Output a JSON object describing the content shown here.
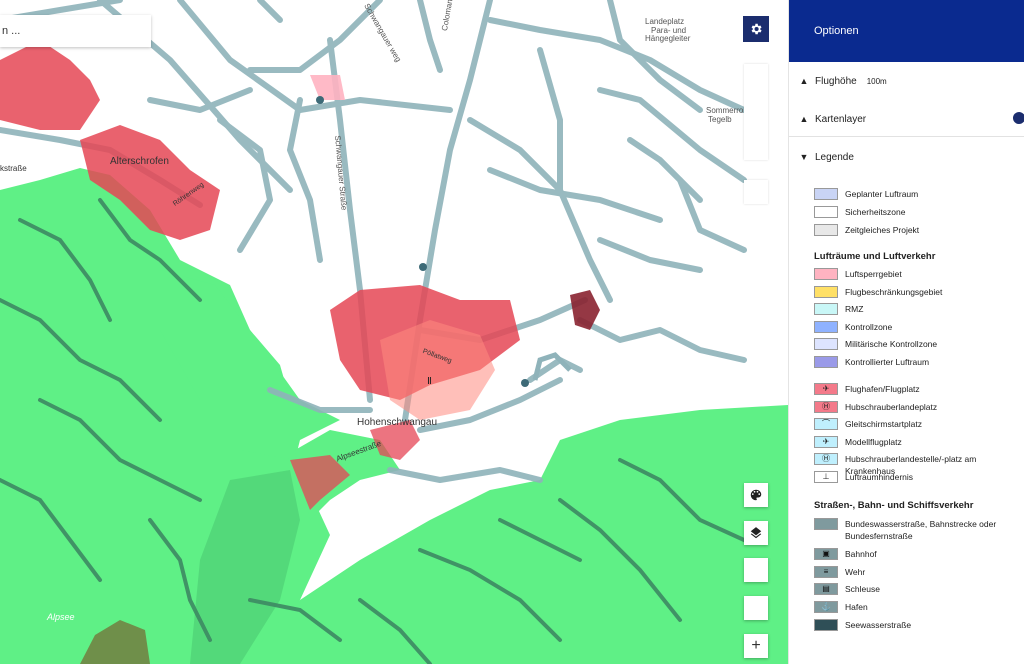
{
  "search": {
    "value": "n ..."
  },
  "map_labels": {
    "landeplatz": "Landeplatz",
    "para": "Para- und",
    "haengegleiter": "Hängegleiter",
    "sommerrodel": "Sommerro",
    "tegelb": "Tegelb",
    "colomanstrasse": "Colomanstraße",
    "schwangauer_strasse": "Schwangauer Straße",
    "alterschrofen": "Alterschrofen",
    "roehrenweg": "Röhrenweg",
    "strasse_left": "kstraße",
    "pollatweg": "Pöllatweg",
    "hohenschwangau": "Hohenschwangau",
    "alpseestrasse": "Alpseestraße",
    "alpsee": "Alpsee",
    "top_road": "Schwangauer weg"
  },
  "controls": {
    "settings_icon": "gear-icon",
    "palette_icon": "palette-icon",
    "layers_icon": "layers-icon",
    "zoom_in": "+"
  },
  "panel": {
    "title": "Optionen",
    "flughoehe_label": "Flughöhe",
    "flughoehe_value": "100m",
    "kartenlayer_label": "Kartenlayer",
    "legende_label": "Legende",
    "legend_top": [
      {
        "label": "Geplanter Luftraum",
        "color": "#c9d4f5"
      },
      {
        "label": "Sicherheitszone",
        "color": "#ffffff"
      },
      {
        "label": "Zeitgleiches Projekt",
        "color": "#e8e8e8"
      }
    ],
    "airspace_heading": "Lufträume und Luftverkehr",
    "airspace_items": [
      {
        "label": "Luftsperrgebiet",
        "color": "#ffb3c1"
      },
      {
        "label": "Flugbeschränkungsgebiet",
        "color": "#ffe066"
      },
      {
        "label": "RMZ",
        "color": "#c9f7f7"
      },
      {
        "label": "Kontrollzone",
        "color": "#8fb2ff"
      },
      {
        "label": "Militärische Kontrollzone",
        "color": "#dde4ff"
      },
      {
        "label": "Kontrollierter Luftraum",
        "color": "#9a9ae8"
      }
    ],
    "airport_items": [
      {
        "label": "Flughafen/Flugplatz",
        "color": "#f47a8a",
        "icon": "airplane-icon"
      },
      {
        "label": "Hubschrauberlandeplatz",
        "color": "#f47a8a",
        "icon": "helipad-icon"
      },
      {
        "label": "Gleitschirmstartplatz",
        "color": "#bfeffd",
        "icon": "paraglider-icon"
      },
      {
        "label": "Modellflugplatz",
        "color": "#bfeffd",
        "icon": "model-plane-icon"
      },
      {
        "label": "Hubschrauberlandestelle/-platz am Krankenhaus",
        "color": "#bfeffd",
        "icon": "hospital-helipad-icon"
      },
      {
        "label": "Luftraumhindernis",
        "color": "#ffffff",
        "icon": "obstacle-icon"
      }
    ],
    "traffic_heading": "Straßen-, Bahn- und Schiffsverkehr",
    "traffic_items": [
      {
        "label": "Bundeswasserstraße, Bahnstrecke oder Bundesfernstraße",
        "color": "#7f9a9e",
        "icon": ""
      },
      {
        "label": "Bahnhof",
        "color": "#7f9a9e",
        "icon": "train-icon"
      },
      {
        "label": "Wehr",
        "color": "#7f9a9e",
        "icon": "weir-icon"
      },
      {
        "label": "Schleuse",
        "color": "#7f9a9e",
        "icon": "lock-icon"
      },
      {
        "label": "Hafen",
        "color": "#7f9a9e",
        "icon": "anchor-icon"
      },
      {
        "label": "Seewasserstraße",
        "color": "#2f4f57",
        "icon": ""
      }
    ]
  }
}
